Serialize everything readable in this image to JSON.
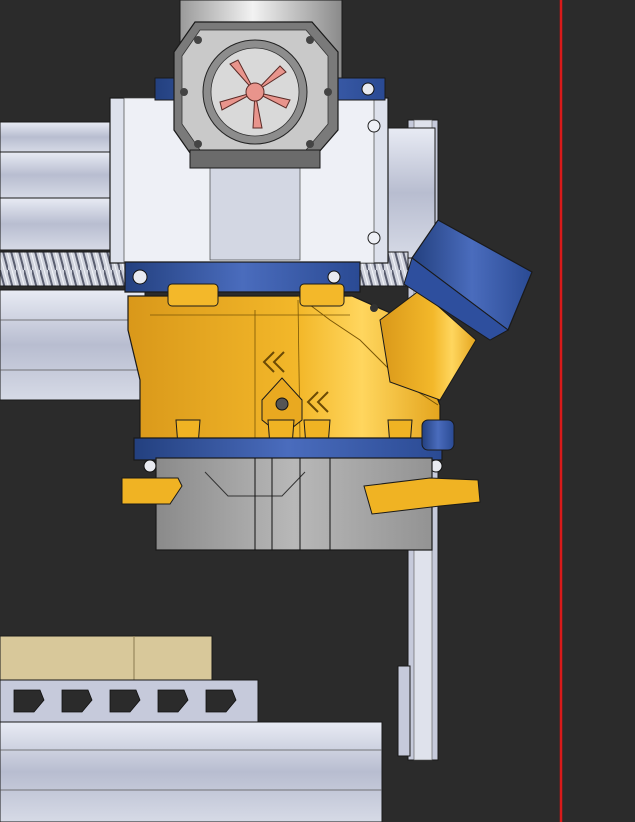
{
  "viewport": {
    "background": "#2b2b2b",
    "boundary_line_color": "#d91a1a"
  },
  "materials": {
    "aluminum": "#c8ccdc",
    "aluminum_light": "#e4e8f2",
    "aluminum_dark": "#8e93a8",
    "gold_part": "#f0b323",
    "gold_light": "#ffd45c",
    "gold_dark": "#b98210",
    "blue_part": "#2e4f9e",
    "blue_light": "#5577c4",
    "gray_part": "#9a9a9a",
    "gray_light": "#bdbdbd",
    "motor_dark": "#6b6b6b",
    "fan_pink": "#e8948c",
    "tan_block": "#d8c89a",
    "edge": "#1a1a1a"
  }
}
